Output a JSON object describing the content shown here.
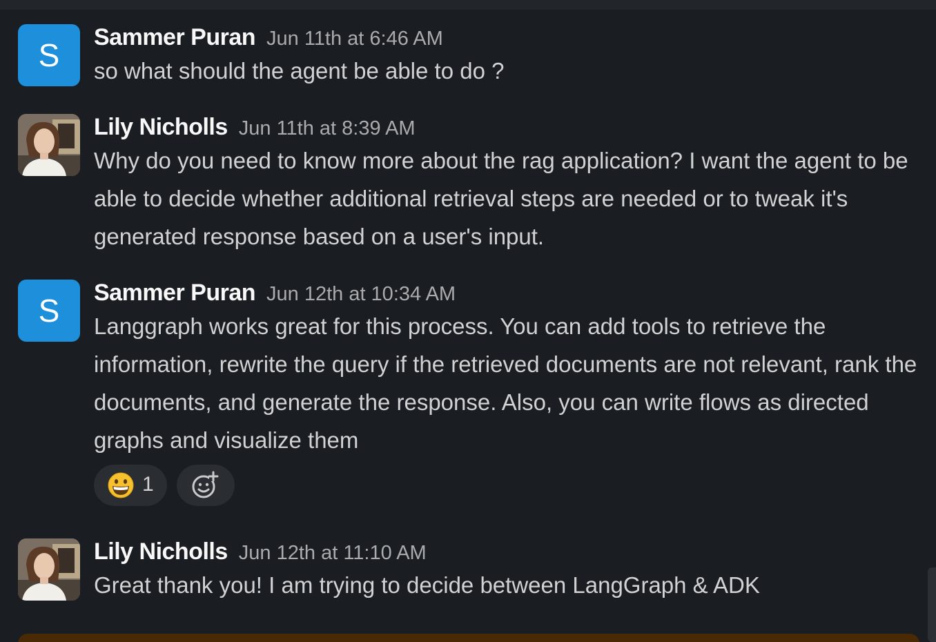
{
  "messages": [
    {
      "author": "Sammer Puran",
      "avatar_initial": "S",
      "timestamp": "Jun 11th at 6:46 AM",
      "text": "so what should the agent be able to do ?"
    },
    {
      "author": "Lily Nicholls",
      "timestamp": "Jun 11th at 8:39 AM",
      "text": "Why do you need to know more about the rag application? I want the agent to be able to decide whether additional retrieval steps are needed or to tweak it's generated response based on a user's input."
    },
    {
      "author": "Sammer Puran",
      "avatar_initial": "S",
      "timestamp": "Jun 12th at 10:34 AM",
      "text": "Langgraph works great for this process. You can add tools to retrieve the information, rewrite the query if the retrieved documents are not relevant, rank the documents, and generate the response. Also, you can write flows as directed graphs and visualize them",
      "reactions": [
        {
          "emoji": "grinning-face-icon",
          "count": "1"
        }
      ]
    },
    {
      "author": "Lily Nicholls",
      "timestamp": "Jun 12th at 11:10 AM",
      "text": "Great thank you! I am trying to decide between LangGraph & ADK"
    }
  ],
  "colors": {
    "background": "#1a1d21",
    "avatar_blue": "#1d8fdb",
    "author_text": "#f8f8f8",
    "timestamp_text": "#a9abad",
    "message_text": "#d1d2d3",
    "reaction_pill": "#2a2d31"
  }
}
